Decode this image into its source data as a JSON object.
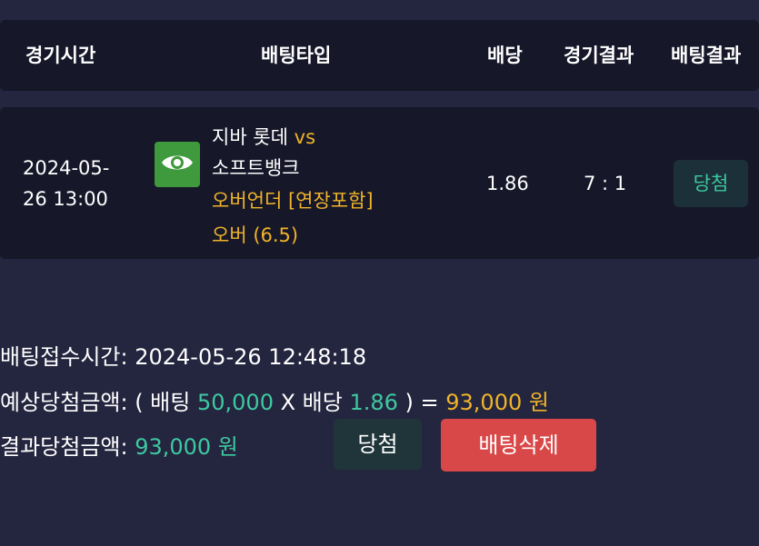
{
  "table_header": {
    "game_time": "경기시간",
    "bet_type": "배팅타입",
    "odds": "배당",
    "game_result": "경기결과",
    "bet_result": "배팅결과"
  },
  "bet_row": {
    "date_line1": "2024-05-",
    "date_line2": "26 13:00",
    "view_icon": "eye-icon",
    "home_team": "지바 롯데",
    "vs": "vs",
    "away_team": "소프트뱅크",
    "market": "오버언더 [연장포함]",
    "pick": "오버 (6.5)",
    "odds": "1.86",
    "score": "7 : 1",
    "result": "당첨"
  },
  "summary": {
    "receipt_label": "배팅접수시간: ",
    "receipt_time": "2024-05-26 12:48:18",
    "expected_label": "예상당첨금액: ( 배팅 ",
    "stake": "50,000",
    "x_odds_label": " X 배당 ",
    "odds": "1.86",
    "equals": " ) = ",
    "expected_amount": "93,000 원",
    "result_label": "결과당첨금액: ",
    "result_amount": "93,000 원"
  },
  "buttons": {
    "win": "당첨",
    "delete": "배팅삭제"
  },
  "colors": {
    "background": "#24253f",
    "card": "#161729",
    "gold": "#f0b429",
    "teal": "#3ec9a0",
    "eye_button": "#3f9a3d",
    "delete_button": "#d94848"
  }
}
